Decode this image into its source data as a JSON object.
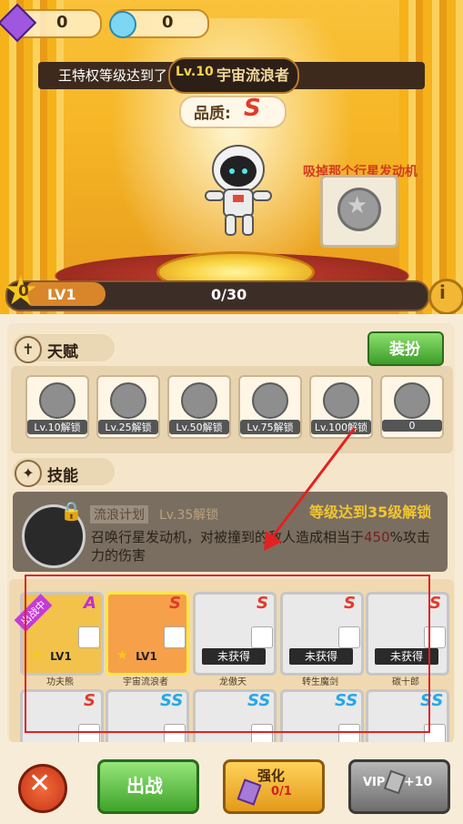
{
  "resources": {
    "gem_purple": "0",
    "gem_blue": "0"
  },
  "banner": {
    "text": "王特权等级达到了",
    "level": "Lv.10",
    "name": "宇宙流浪者"
  },
  "quality": {
    "label": "品质:",
    "grade": "S"
  },
  "hint": "吸掉那个行星发动机",
  "progress": {
    "stars": "0",
    "level": "LV1",
    "text": "0/30",
    "fraction": 0.0
  },
  "talent": {
    "title": "天赋",
    "dress_button": "装扮",
    "slots": [
      {
        "label": "Lv.10解锁",
        "icon": "flame-icon"
      },
      {
        "label": "Lv.25解锁",
        "icon": "vortex-icon"
      },
      {
        "label": "Lv.50解锁",
        "icon": "flame-icon"
      },
      {
        "label": "Lv.75解锁",
        "icon": "flame-icon"
      },
      {
        "label": "Lv.100解锁",
        "icon": "vortex-icon"
      },
      {
        "label": "0",
        "icon": "flame-icon"
      }
    ]
  },
  "skill": {
    "title": "技能",
    "name": "流浪计划",
    "level_lock": "Lv.35解锁",
    "unlock_hint": "等级达到35级解锁",
    "description_a": "召唤行星发动机，对被撞到的敌人造成相当于",
    "description_value": "450",
    "description_b": "%攻击力的伤害"
  },
  "heroes_row1": [
    {
      "name": "功夫熊",
      "grade": "A",
      "status": "LV1",
      "badge": "出战中",
      "stars": "0"
    },
    {
      "name": "宇宙流浪者",
      "grade": "S",
      "status": "LV1",
      "stars": "0"
    },
    {
      "name": "龙傲天",
      "grade": "S",
      "status": "未获得"
    },
    {
      "name": "转生魔剑",
      "grade": "S",
      "status": "未获得"
    },
    {
      "name": "碳十郎",
      "grade": "S",
      "status": "未获得"
    }
  ],
  "heroes_row2": [
    {
      "grade": "S"
    },
    {
      "grade": "SS"
    },
    {
      "grade": "SS"
    },
    {
      "grade": "SS"
    },
    {
      "grade": "SS"
    }
  ],
  "bottom": {
    "fight": "出战",
    "upgrade": "强化",
    "upgrade_count": "0/1",
    "vip": "VIP",
    "vip_count": "+10"
  },
  "colors": {
    "grade_s": "#e33a2b",
    "grade_ss": "#27a7e8",
    "grade_a": "#c22bd6"
  }
}
